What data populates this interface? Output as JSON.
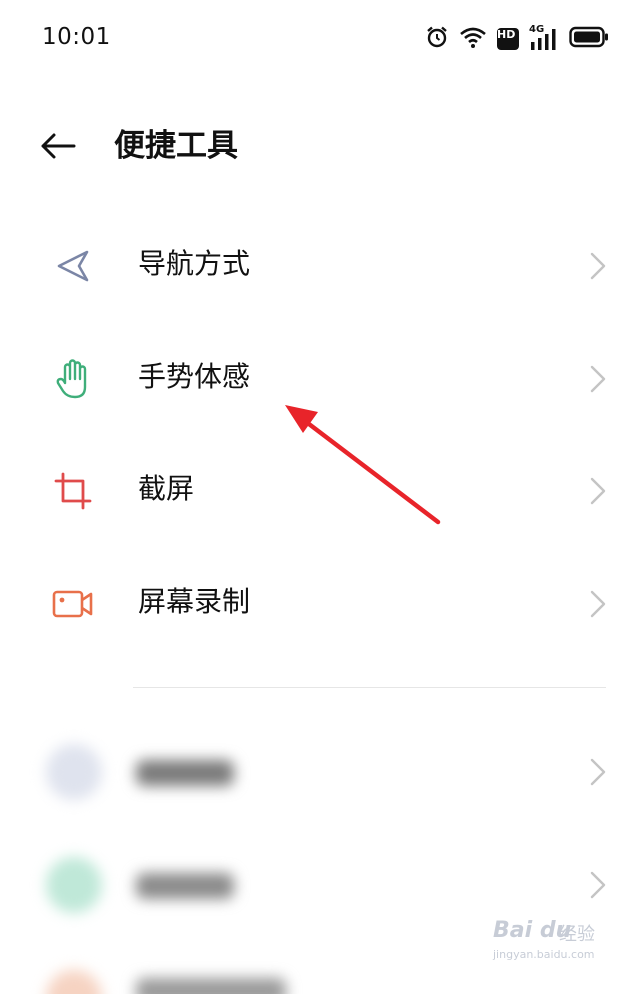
{
  "status_bar": {
    "time": "10:01",
    "icons": [
      "alarm-icon",
      "wifi-icon",
      "hd-badge",
      "signal-4g-icon",
      "battery-icon"
    ],
    "hd_label": "HD",
    "network_label": "4G"
  },
  "header": {
    "title": "便捷工具",
    "back_icon": "back-arrow-icon"
  },
  "items": [
    {
      "label": "导航方式",
      "icon": "navigation-icon",
      "color": "#7b86a6"
    },
    {
      "label": "手势体感",
      "icon": "hand-gesture-icon",
      "color": "#3fae7a"
    },
    {
      "label": "截屏",
      "icon": "crop-icon",
      "color": "#e04b4b"
    },
    {
      "label": "屏幕录制",
      "icon": "video-camera-icon",
      "color": "#e8704a"
    }
  ],
  "annotation": {
    "type": "red-arrow",
    "color": "#e8242a"
  },
  "watermark": {
    "brand": "Bai du",
    "brand_cn": "经验",
    "url": "jingyan.baidu.com"
  }
}
